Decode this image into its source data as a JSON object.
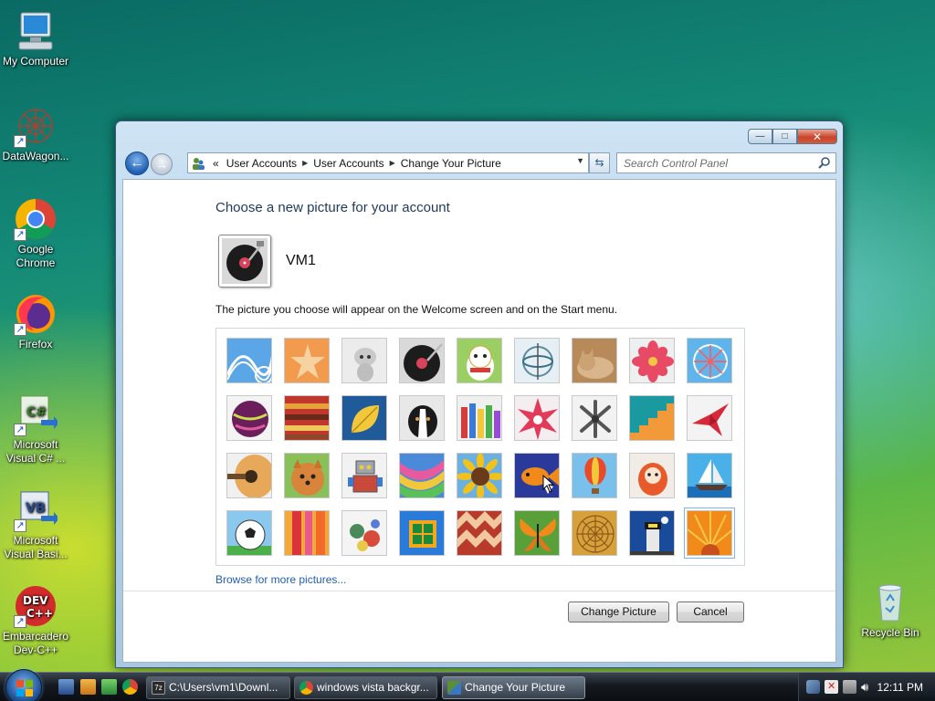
{
  "desktop": {
    "icons": [
      {
        "label": "My Computer"
      },
      {
        "label": "DataWagon..."
      },
      {
        "label": "Google Chrome"
      },
      {
        "label": "Firefox"
      },
      {
        "label": "Microsoft Visual C# ..."
      },
      {
        "label": "Microsoft Visual Basi..."
      },
      {
        "label": "Embarcadero Dev-C++"
      },
      {
        "label": "Recycle Bin"
      }
    ]
  },
  "window": {
    "breadcrumbs": [
      "User Accounts",
      "User Accounts",
      "Change Your Picture"
    ],
    "breadcrumb_overflow": "«",
    "search_placeholder": "Search Control Panel",
    "heading": "Choose a new picture for your account",
    "user_name": "VM1",
    "description": "The picture you choose will appear on the Welcome screen and on the Start menu.",
    "pictures": [
      {
        "icon": "roller-coaster"
      },
      {
        "icon": "starfish"
      },
      {
        "icon": "robot-dog"
      },
      {
        "icon": "vinyl-record"
      },
      {
        "icon": "lucky-cat"
      },
      {
        "icon": "gyroscope"
      },
      {
        "icon": "kitten"
      },
      {
        "icon": "flower-pink"
      },
      {
        "icon": "ferris-wheel"
      },
      {
        "icon": "ball-purple"
      },
      {
        "icon": "fabric-stripes"
      },
      {
        "icon": "leaf-yellow"
      },
      {
        "icon": "dog-border-collie"
      },
      {
        "icon": "crayons"
      },
      {
        "icon": "star-lantern"
      },
      {
        "icon": "jacks"
      },
      {
        "icon": "stairs"
      },
      {
        "icon": "paper-crane"
      },
      {
        "icon": "guitar"
      },
      {
        "icon": "pomeranian"
      },
      {
        "icon": "toy-robot"
      },
      {
        "icon": "rainbow-fabric"
      },
      {
        "icon": "sunflower"
      },
      {
        "icon": "fish"
      },
      {
        "icon": "hot-air-balloon"
      },
      {
        "icon": "daruma-doll"
      },
      {
        "icon": "sailboat"
      },
      {
        "icon": "soccer-ball"
      },
      {
        "icon": "cloth-stack"
      },
      {
        "icon": "marbles"
      },
      {
        "icon": "window-green"
      },
      {
        "icon": "rug-pattern"
      },
      {
        "icon": "butterfly"
      },
      {
        "icon": "shell-spiral"
      },
      {
        "icon": "lighthouse"
      },
      {
        "icon": "flower-orange"
      }
    ],
    "selected_picture_index": 35,
    "browse_link": "Browse for more pictures...",
    "change_button": "Change Picture",
    "cancel_button": "Cancel",
    "minimize": "—",
    "maximize": "□",
    "close": "✕"
  },
  "taskbar": {
    "tasks": [
      {
        "label": "C:\\Users\\vm1\\Downl...",
        "icon": "7zip-icon"
      },
      {
        "label": "windows vista backgr...",
        "icon": "chrome-icon"
      },
      {
        "label": "Change Your Picture",
        "icon": "user-accounts-icon"
      }
    ],
    "clock": "12:11 PM"
  }
}
